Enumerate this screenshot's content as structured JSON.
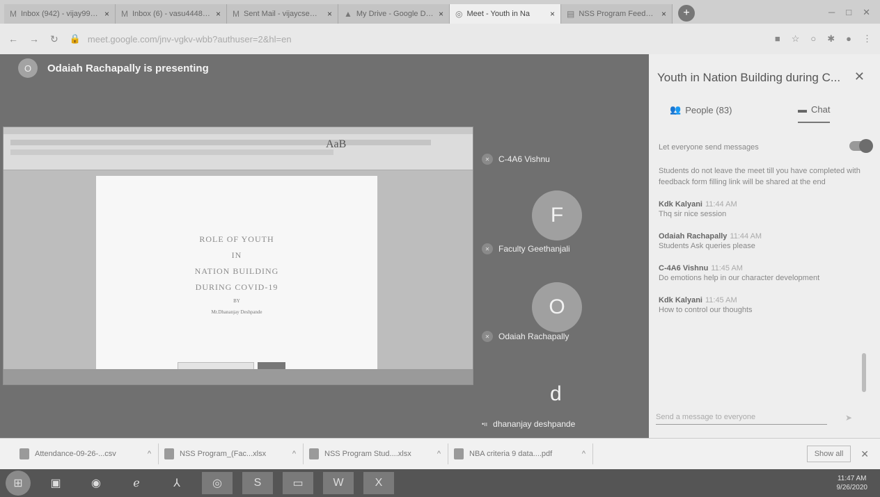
{
  "browser": {
    "tabs": [
      {
        "label": "Inbox (942) - vijay995...",
        "icon": "gmail-icon"
      },
      {
        "label": "Inbox (6) - vasu44482...",
        "icon": "gmail-icon"
      },
      {
        "label": "Sent Mail - vijaycse@g...",
        "icon": "gmail-icon"
      },
      {
        "label": "My Drive - Google Drive",
        "icon": "drive-icon"
      },
      {
        "label": "Meet - Youth in Na",
        "icon": "meet-icon"
      },
      {
        "label": "NSS Program Feedback",
        "icon": "forms-icon"
      }
    ],
    "url": "meet.google.com/jnv-vgkv-wbb?authuser=2&hl=en"
  },
  "meeting": {
    "presenter_avatar": "O",
    "presenter_text": "Odaiah Rachapally is presenting",
    "participants": [
      {
        "name": "C-4A6 Vishnu"
      },
      {
        "name": "Faculty Geethanjali",
        "avatar": "F"
      },
      {
        "name": "Odaiah Rachapally",
        "avatar": "O"
      },
      {
        "name": "dhananjay deshpande",
        "avatar": "d"
      }
    ]
  },
  "shared_doc": {
    "aab": "AaB",
    "title_lines": [
      "ROLE OF YOUTH",
      "IN",
      "NATION BUILDING",
      "DURING COVID-19"
    ],
    "by": "BY",
    "author": "Mr.Dhananjay Deshpande"
  },
  "panel": {
    "title": "Youth in Nation Building during C...",
    "tabs": {
      "people": "People (83)",
      "chat": "Chat"
    },
    "toggle_label": "Let everyone send messages",
    "messages": [
      {
        "sender": "",
        "time": "",
        "text": "Students do not leave the meet till you have completed with feedback form filling link will be shared at the end"
      },
      {
        "sender": "Kdk Kalyani",
        "time": "11:44 AM",
        "text": "Thq sir nice session"
      },
      {
        "sender": "Odaiah Rachapally",
        "time": "11:44 AM",
        "text": "Students Ask queries please"
      },
      {
        "sender": "C-4A6 Vishnu",
        "time": "11:45 AM",
        "text": "Do emotions help in our character development"
      },
      {
        "sender": "Kdk Kalyani",
        "time": "11:45 AM",
        "text": "How to control our thoughts"
      }
    ],
    "send_placeholder": "Send a message to everyone"
  },
  "downloads": {
    "items": [
      {
        "name": "Attendance-09-26-...csv"
      },
      {
        "name": "NSS Program_(Fac...xlsx"
      },
      {
        "name": "NSS Program Stud....xlsx"
      },
      {
        "name": "NBA criteria 9 data....pdf"
      }
    ],
    "show_all": "Show all"
  },
  "taskbar": {
    "time": "11:47 AM",
    "date": "9/26/2020"
  }
}
